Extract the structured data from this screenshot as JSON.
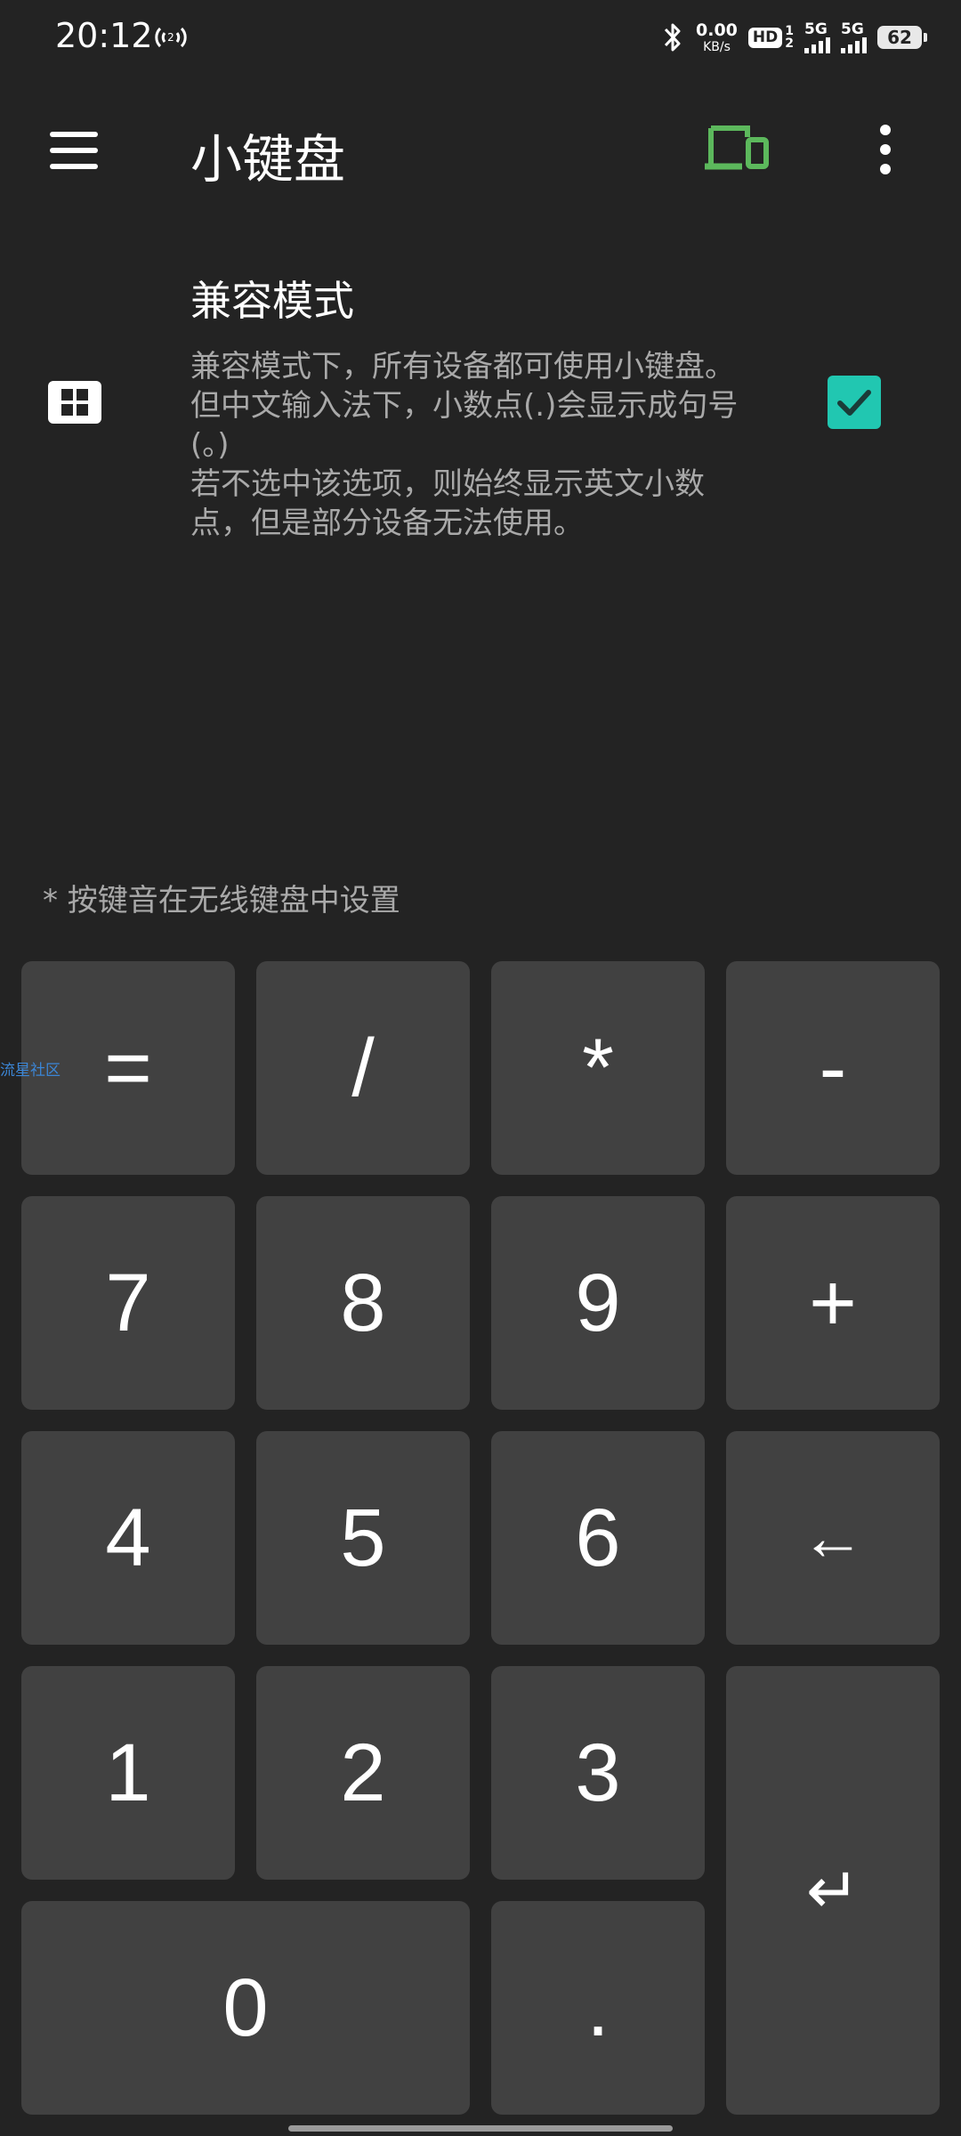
{
  "status_bar": {
    "time": "20:12",
    "hotspot_count": "2",
    "net_speed_value": "0.00",
    "net_speed_unit": "KB/s",
    "hd_label": "HD",
    "hd_sim1": "1",
    "hd_sim2": "2",
    "signal1_gen": "5G",
    "signal2_gen": "5G",
    "battery_level": "62"
  },
  "app_bar": {
    "title": "小键盘",
    "accent_color": "#5cb85c"
  },
  "setting": {
    "title": "兼容模式",
    "description": "兼容模式下，所有设备都可使用小键盘。\n但中文输入法下，小数点(.)会显示成句号\n(。)\n若不选中该选项，则始终显示英文小数\n点，但是部分设备无法使用。",
    "checked": true,
    "checkbox_color": "#21c7b1"
  },
  "hint": "* 按键音在无线键盘中设置",
  "watermark": "流星社区",
  "keys": {
    "equals": "=",
    "divide": "/",
    "multiply": "*",
    "minus": "-",
    "k7": "7",
    "k8": "8",
    "k9": "9",
    "plus": "+",
    "k4": "4",
    "k5": "5",
    "k6": "6",
    "backspace": "←",
    "k1": "1",
    "k2": "2",
    "k3": "3",
    "enter": "↵",
    "k0": "0",
    "dot": "."
  }
}
